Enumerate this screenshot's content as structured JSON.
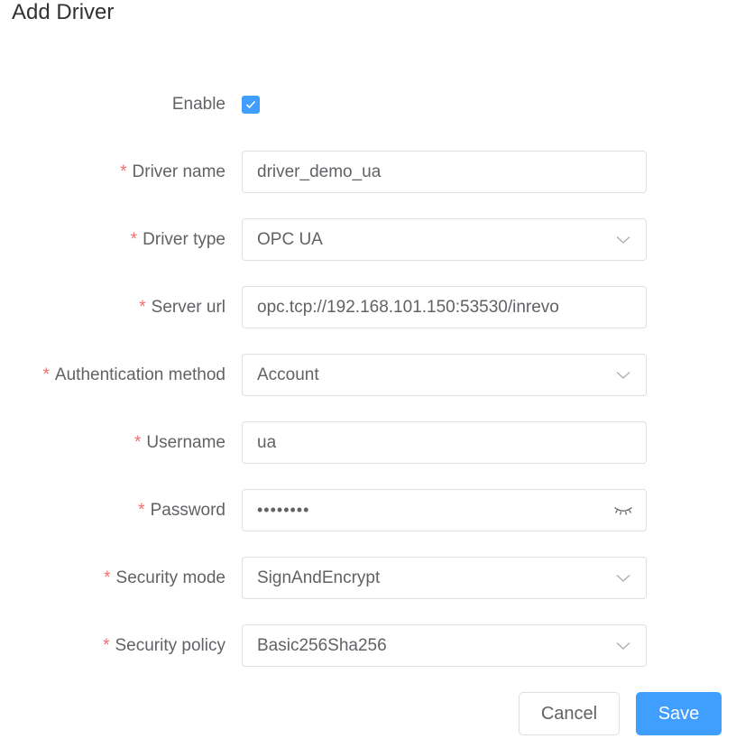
{
  "dialog": {
    "title": "Add Driver"
  },
  "form": {
    "enable": {
      "label": "Enable",
      "checked": true
    },
    "driver_name": {
      "label": "Driver name",
      "required_mark": "*",
      "value": "driver_demo_ua"
    },
    "driver_type": {
      "label": "Driver type",
      "required_mark": "*",
      "value": "OPC UA",
      "icon": "chevron-down-icon"
    },
    "server_url": {
      "label": "Server url",
      "required_mark": "*",
      "value": "opc.tcp://192.168.101.150:53530/inrevo"
    },
    "auth_method": {
      "label": "Authentication method",
      "required_mark": "*",
      "value": "Account",
      "icon": "chevron-down-icon"
    },
    "username": {
      "label": "Username",
      "required_mark": "*",
      "value": "ua"
    },
    "password": {
      "label": "Password",
      "required_mark": "*",
      "value": "••••••••",
      "icon": "eye-closed-icon"
    },
    "security_mode": {
      "label": "Security mode",
      "required_mark": "*",
      "value": "SignAndEncrypt",
      "icon": "chevron-down-icon"
    },
    "security_policy": {
      "label": "Security policy",
      "required_mark": "*",
      "value": "Basic256Sha256",
      "icon": "chevron-down-icon"
    }
  },
  "buttons": {
    "cancel": "Cancel",
    "save": "Save"
  },
  "colors": {
    "primary": "#409eff",
    "required": "#f56c6c",
    "border": "#dcdfe6",
    "label": "#606266"
  }
}
